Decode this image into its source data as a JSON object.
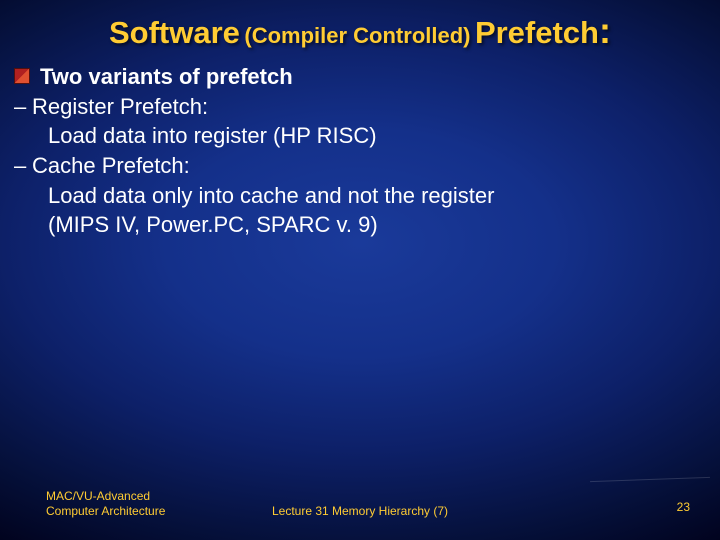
{
  "title": {
    "part1": "Software",
    "part2": "(Compiler Controlled)",
    "part3": "Prefetch",
    "colon": ":"
  },
  "body": {
    "bullet1": "Two variants of prefetch",
    "item1_label": "Register Prefetch:",
    "item1_desc": "Load data into register (HP RISC)",
    "item2_label": "Cache Prefetch:",
    "item2_desc_l1": "Load data only into cache and not the register",
    "item2_desc_l2": "(MIPS IV, Power.PC, SPARC v. 9)",
    "dash": "–"
  },
  "footer": {
    "left_l1": "MAC/VU-Advanced",
    "left_l2": "Computer Architecture",
    "mid": "Lecture 31 Memory Hierarchy (7)",
    "right": "23"
  }
}
